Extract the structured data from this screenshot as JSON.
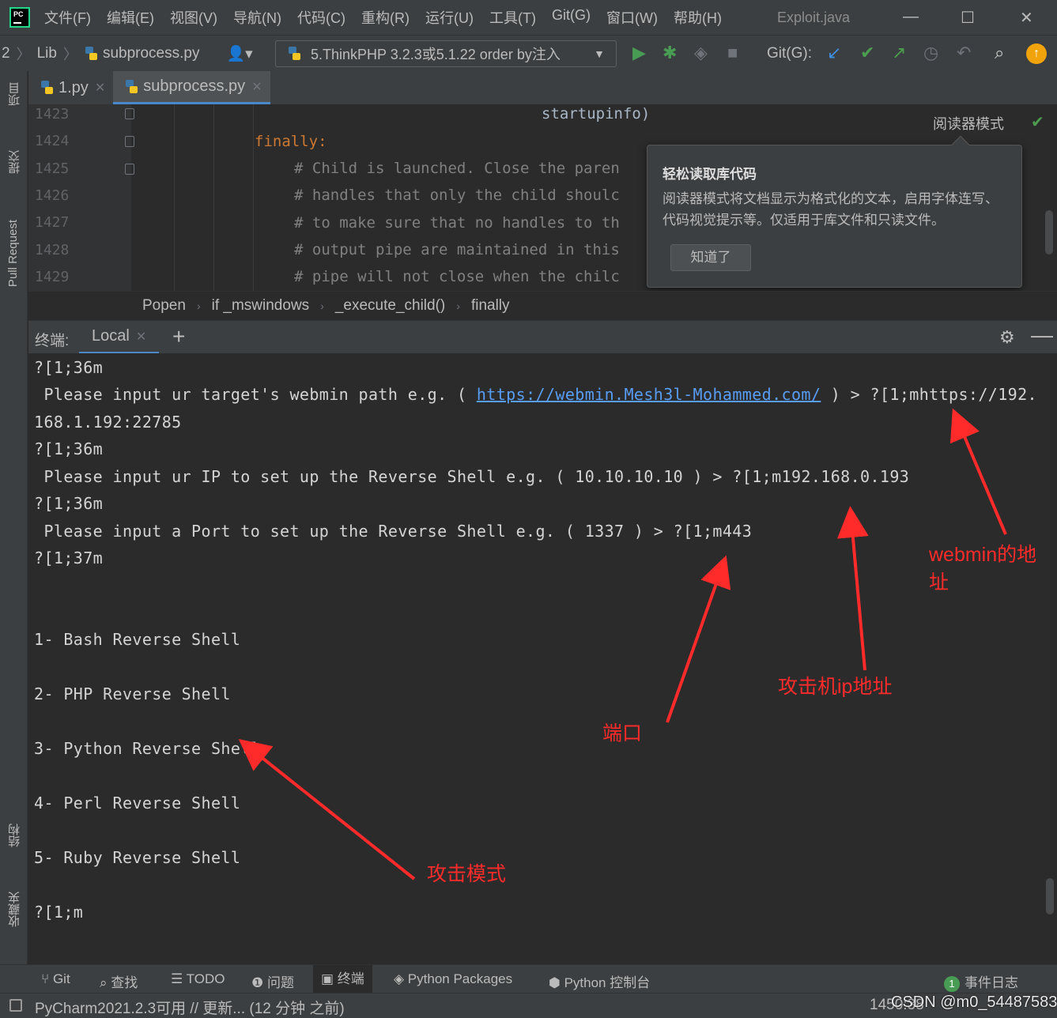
{
  "window": {
    "title": "Exploit.java",
    "minimize": "—",
    "maximize": "☐",
    "close": "✕"
  },
  "menu": {
    "items": [
      "文件(F)",
      "编辑(E)",
      "视图(V)",
      "导航(N)",
      "代码(C)",
      "重构(R)",
      "运行(U)",
      "工具(T)",
      "Git(G)",
      "窗口(W)",
      "帮助(H)"
    ]
  },
  "navbar": {
    "crumb_prefix": "2",
    "crumb_lib": "Lib",
    "crumb_file": "subprocess.py",
    "run_config": "5.ThinkPHP 3.2.3或5.1.22 order by注入",
    "git_label": "Git(G):"
  },
  "sidebar": {
    "project": "项目",
    "commit": "提交",
    "pull_request": "Pull Request",
    "structure": "结构",
    "favorites": "收藏夹"
  },
  "editor": {
    "tabs": [
      {
        "label": "1.py"
      },
      {
        "label": "subprocess.py"
      }
    ],
    "line_numbers": [
      "1423",
      "1424",
      "1425",
      "1426",
      "1427",
      "1428",
      "1429"
    ],
    "lines": [
      "startupinfo)",
      "finally:",
      "# Child is launched. Close the paren",
      "# handles that only the child shoulc",
      "# to make sure that no handles to th",
      "# output pipe are maintained in this",
      "# pipe will not close when the chilc"
    ],
    "reader_mode": "阅读器模式"
  },
  "popup": {
    "title": "轻松读取库代码",
    "body": "阅读器模式将文档显示为格式化的文本，启用字体连写、代码视觉提示等。仅适用于库文件和只读文件。",
    "button": "知道了"
  },
  "breadcrumb": {
    "items": [
      "Popen",
      "if _mswindows",
      "_execute_child()",
      "finally"
    ]
  },
  "terminal": {
    "label": "终端:",
    "tab": "Local",
    "lines": [
      "?[1;36m",
      " Please input ur target's webmin path e.g. ( ",
      "168.1.192:22785",
      "?[1;36m",
      " Please input ur IP to set up the Reverse Shell e.g. ( 10.10.10.10 ) > ?[1;m192.168.0.193",
      "?[1;36m",
      " Please input a Port to set up the Reverse Shell e.g. ( 1337 ) > ?[1;m443",
      "?[1;37m",
      "1- Bash Reverse Shell",
      "2- PHP Reverse Shell",
      "3- Python Reverse Shell",
      "4- Perl Reverse Shell",
      "5- Ruby Reverse Shell",
      "?[1;m"
    ],
    "link": "https://webmin.Mesh3l-Mohammed.com/",
    "line2_suffix": " ) > ?[1;mhttps://192."
  },
  "annotations": {
    "webmin": "webmin的地",
    "webmin2": "址",
    "attacker_ip": "攻击机ip地址",
    "port": "端口",
    "attack_mode": "攻击模式",
    "color": "#ff2b2b"
  },
  "bottombar": {
    "git": "Git",
    "find": "查找",
    "todo": "TODO",
    "problems": "问题",
    "terminal": "终端",
    "python_packages": "Python Packages",
    "python_console": "Python 控制台",
    "event_log": "事件日志",
    "event_count": "1"
  },
  "statusbar": {
    "message": "PyCharm2021.2.3可用 // 更新... (12 分钟 之前)",
    "position": "1450:38",
    "watermark": "CSDN @m0_54487583"
  }
}
